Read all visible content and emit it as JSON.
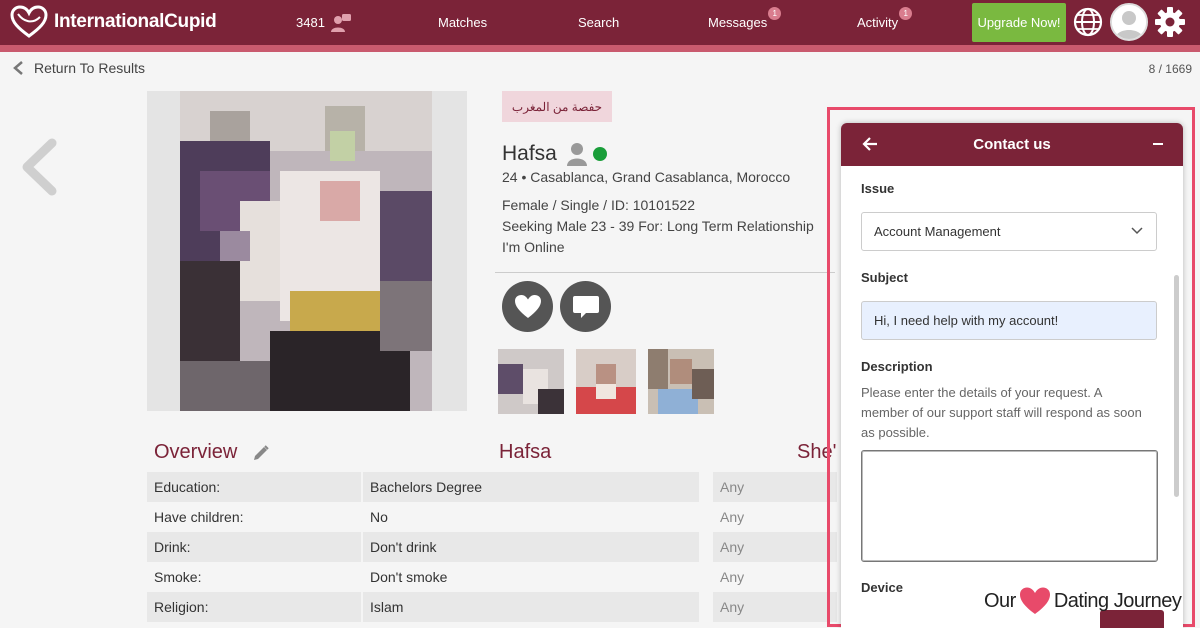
{
  "header": {
    "brand": "InternationalCupid",
    "interest_count": "3481",
    "nav": [
      {
        "label": "Matches",
        "badge": ""
      },
      {
        "label": "Search",
        "badge": ""
      },
      {
        "label": "Messages",
        "badge": "1"
      },
      {
        "label": "Activity",
        "badge": "1"
      }
    ],
    "upgrade_label": "Upgrade Now!"
  },
  "subheader": {
    "back_label": "Return To Results",
    "position": "8 / 1669"
  },
  "profile": {
    "tagline": "حفصة من المغرب",
    "name": "Hafsa",
    "location_line": "24 • Casablanca, Grand Casablanca, Morocco",
    "details_line": "Female / Single / ID: 10101522",
    "seeking_line": "Seeking Male 23 - 39 For: Long Term Relationship",
    "status_line": "I'm Online"
  },
  "overview": {
    "title": "Overview",
    "col_profile": "Hafsa",
    "col_seeking": "She's",
    "rows": [
      {
        "label": "Education:",
        "value": "Bachelors Degree",
        "seeking": "Any"
      },
      {
        "label": "Have children:",
        "value": "No",
        "seeking": "Any"
      },
      {
        "label": "Drink:",
        "value": "Don't drink",
        "seeking": "Any"
      },
      {
        "label": "Smoke:",
        "value": "Don't smoke",
        "seeking": "Any"
      },
      {
        "label": "Religion:",
        "value": "Islam",
        "seeking": "Any"
      }
    ]
  },
  "contact": {
    "title": "Contact us",
    "issue_label": "Issue",
    "issue_value": "Account Management",
    "subject_label": "Subject",
    "subject_value": "Hi, I need help with my account!",
    "description_label": "Description",
    "description_help": "Please enter the details of your request. A member of our support staff will respond as soon as possible.",
    "device_label": "Device"
  },
  "watermark": {
    "left": "Our",
    "right": "Dating Journey"
  },
  "colors": {
    "brand": "#7b2338",
    "accent_green": "#7ab940",
    "online": "#1a9e3a",
    "highlight_border": "#e84a6a"
  }
}
